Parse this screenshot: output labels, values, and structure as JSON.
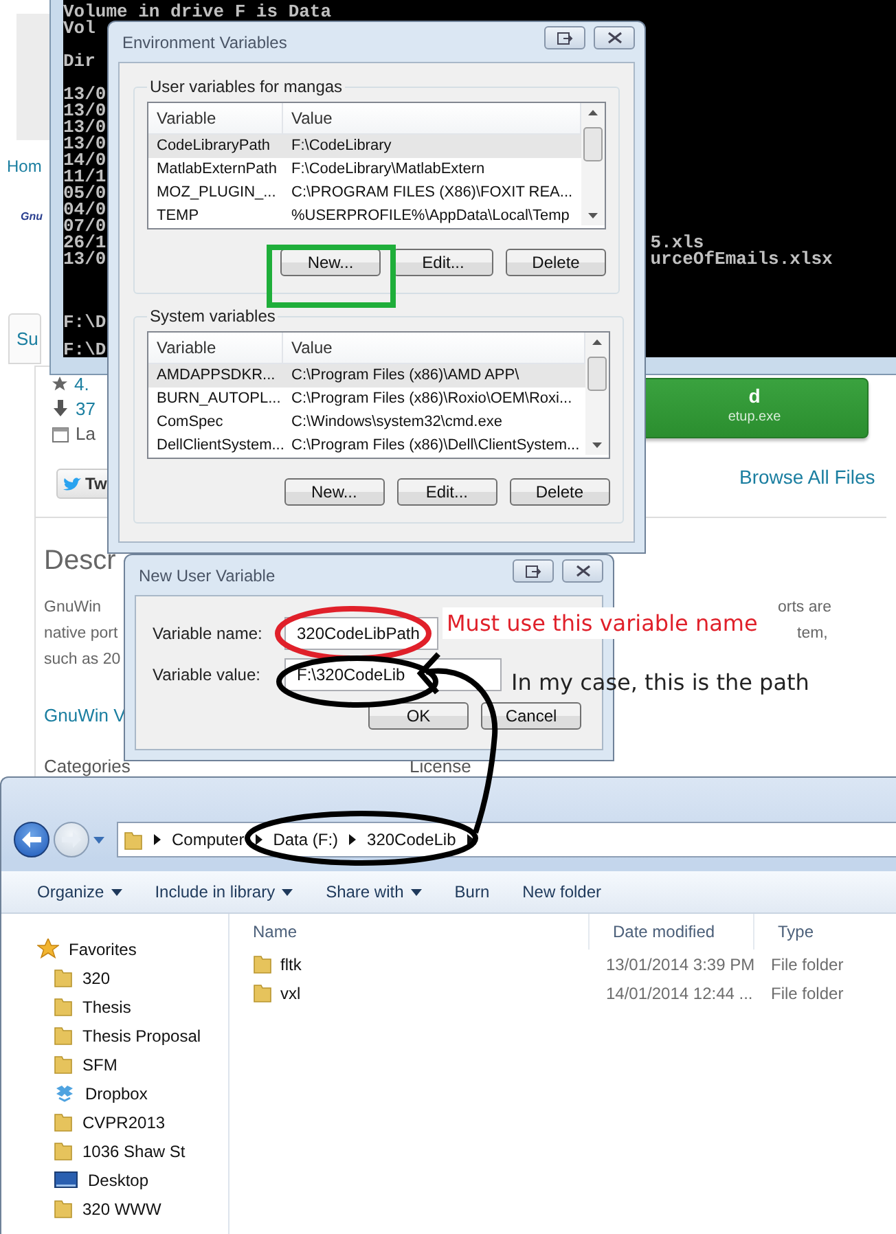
{
  "web_page": {
    "nav_link": "Hom",
    "logo": "Gnu",
    "tab": "Su",
    "stats": [
      {
        "kind": "rating",
        "text": "4."
      },
      {
        "kind": "downloads",
        "text": "37"
      },
      {
        "kind": "updated",
        "text": "La"
      }
    ],
    "tweet_button": "Tw",
    "download_button": {
      "title": "d",
      "file": "etup.exe"
    },
    "browse_link": "Browse All Files",
    "description_heading": "Descr",
    "description_left": [
      "GnuWin",
      "native port",
      "such as 20"
    ],
    "description_right": [
      "orts are",
      "tem,"
    ],
    "link": "GnuWin V",
    "categories_heading": "Categories",
    "license_heading": "License"
  },
  "console": {
    "header": [
      "Volume in drive F is Data",
      "Vol",
      "Dir"
    ],
    "listing": [
      {
        "date": "13/0"
      },
      {
        "date": "13/0"
      },
      {
        "date": "13/0"
      },
      {
        "date": "13/0"
      },
      {
        "date": "14/0"
      },
      {
        "date": "11/1"
      },
      {
        "date": "05/0"
      },
      {
        "date": "04/0"
      },
      {
        "date": "07/0"
      },
      {
        "date": "26/1",
        "name": "5.xls"
      },
      {
        "date": "13/0",
        "name": "urceOfEmails.xlsx"
      }
    ],
    "prompts": [
      "F:\\D",
      "F:\\D"
    ]
  },
  "env_dialog": {
    "title": "Environment Variables",
    "groups": [
      {
        "label": "User variables for mangas",
        "columns": [
          "Variable",
          "Value"
        ],
        "rows": [
          {
            "variable": "CodeLibraryPath",
            "value": "F:\\CodeLibrary",
            "selected": true
          },
          {
            "variable": "MatlabExternPath",
            "value": "F:\\CodeLibrary\\MatlabExtern",
            "selected": false
          },
          {
            "variable": "MOZ_PLUGIN_...",
            "value": "C:\\PROGRAM FILES (X86)\\FOXIT REA...",
            "selected": false
          },
          {
            "variable": "TEMP",
            "value": "%USERPROFILE%\\AppData\\Local\\Temp",
            "selected": false
          }
        ],
        "buttons": [
          "New...",
          "Edit...",
          "Delete"
        ]
      },
      {
        "label": "System variables",
        "columns": [
          "Variable",
          "Value"
        ],
        "rows": [
          {
            "variable": "AMDAPPSDKR...",
            "value": "C:\\Program Files (x86)\\AMD APP\\",
            "selected": true
          },
          {
            "variable": "BURN_AUTOPL...",
            "value": "C:\\Program Files (x86)\\Roxio\\OEM\\Roxi...",
            "selected": false
          },
          {
            "variable": "ComSpec",
            "value": "C:\\Windows\\system32\\cmd.exe",
            "selected": false
          },
          {
            "variable": "DellClientSystem...",
            "value": "C:\\Program Files (x86)\\Dell\\ClientSystem...",
            "selected": false
          }
        ],
        "buttons": [
          "New...",
          "Edit...",
          "Delete"
        ]
      }
    ]
  },
  "new_variable_dialog": {
    "title": "New User Variable",
    "fields": [
      {
        "label": "Variable name:",
        "value": "320CodeLibPath"
      },
      {
        "label": "Variable value:",
        "value": "F:\\320CodeLib"
      }
    ],
    "buttons": [
      "OK",
      "Cancel"
    ]
  },
  "notes": [
    {
      "text": "Must use this variable name",
      "color": "#e0202a"
    },
    {
      "text": "In my case, this is the path",
      "color": "#222222"
    }
  ],
  "explorer": {
    "address": [
      "Computer",
      "Data (F:)",
      "320CodeLib"
    ],
    "toolbar": [
      {
        "label": "Organize",
        "menu": true
      },
      {
        "label": "Include in library",
        "menu": true
      },
      {
        "label": "Share with",
        "menu": true
      },
      {
        "label": "Burn",
        "menu": false
      },
      {
        "label": "New folder",
        "menu": false
      }
    ],
    "favorites": {
      "label": "Favorites",
      "items": [
        {
          "name": "320",
          "kind": "folder"
        },
        {
          "name": "Thesis",
          "kind": "folder"
        },
        {
          "name": "Thesis Proposal",
          "kind": "folder"
        },
        {
          "name": "SFM",
          "kind": "folder"
        },
        {
          "name": "Dropbox",
          "kind": "dropbox"
        },
        {
          "name": "CVPR2013",
          "kind": "folder"
        },
        {
          "name": "1036 Shaw St",
          "kind": "folder"
        },
        {
          "name": "Desktop",
          "kind": "desktop"
        },
        {
          "name": "320 WWW",
          "kind": "folder"
        }
      ]
    },
    "columns": [
      "Name",
      "Date modified",
      "Type"
    ],
    "files": [
      {
        "name": "fltk",
        "date": "13/01/2014 3:39 PM",
        "type": "File folder"
      },
      {
        "name": "vxl",
        "date": "14/01/2014 12:44 ...",
        "type": "File folder"
      }
    ]
  }
}
